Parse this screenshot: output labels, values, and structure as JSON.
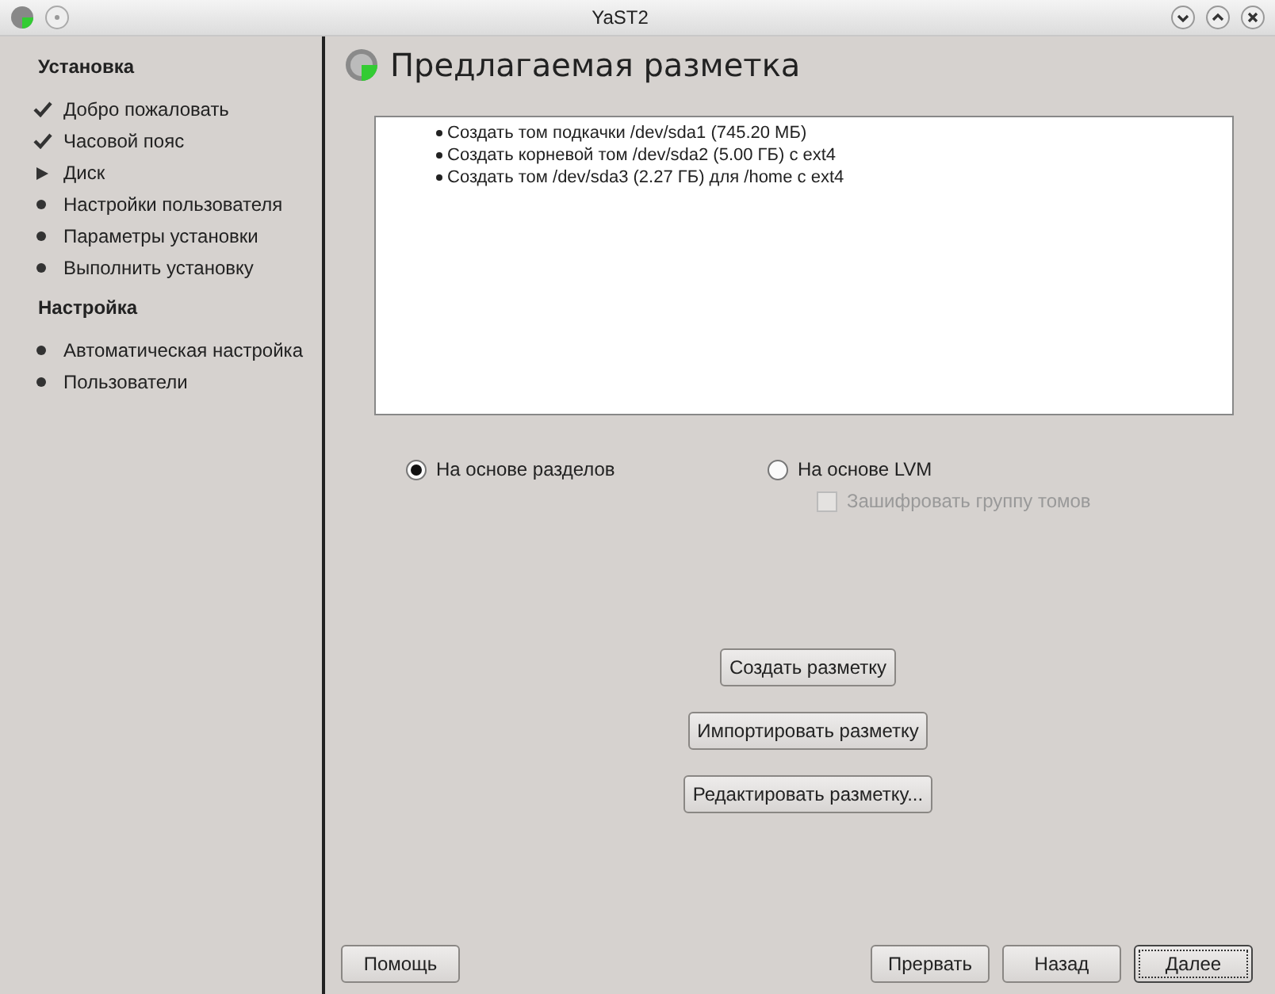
{
  "window": {
    "title": "YaST2"
  },
  "sidebar": {
    "sections": [
      {
        "title": "Установка",
        "items": [
          {
            "label": "Добро пожаловать",
            "kind": "done"
          },
          {
            "label": "Часовой пояс",
            "kind": "done"
          },
          {
            "label": "Диск",
            "kind": "current"
          },
          {
            "label": "Настройки пользователя",
            "kind": "pending"
          },
          {
            "label": "Параметры установки",
            "kind": "pending"
          },
          {
            "label": "Выполнить установку",
            "kind": "pending"
          }
        ]
      },
      {
        "title": "Настройка",
        "items": [
          {
            "label": "Автоматическая настройка",
            "kind": "pending"
          },
          {
            "label": "Пользователи",
            "kind": "pending"
          }
        ]
      }
    ]
  },
  "page": {
    "title": "Предлагаемая разметка",
    "proposal": [
      "Создать том подкачки /dev/sda1 (745.20 МБ)",
      "Создать корневой том /dev/sda2 (5.00 ГБ) с ext4",
      "Создать том /dev/sda3 (2.27 ГБ) для /home с ext4"
    ],
    "radios": [
      {
        "label": "На основе разделов",
        "selected": true
      },
      {
        "label": "На основе LVM",
        "selected": false
      }
    ],
    "encrypt": {
      "label": "Зашифровать группу томов",
      "checked": false,
      "disabled": true
    },
    "actions": [
      "Создать разметку",
      "Импортировать разметку",
      "Редактировать разметку..."
    ]
  },
  "footer": {
    "help": "Помощь",
    "buttons": [
      {
        "label": "Прервать",
        "default": false
      },
      {
        "label": "Назад",
        "default": false
      },
      {
        "label": "Далее",
        "default": true
      }
    ]
  }
}
